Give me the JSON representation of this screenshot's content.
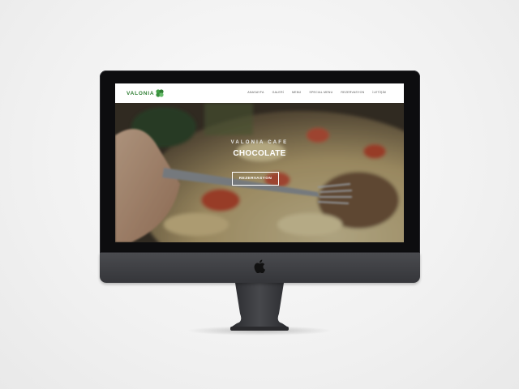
{
  "site": {
    "brand": "VALONIA",
    "brand_icon": "clover-leaf-icon",
    "brand_color": "#2e7d32"
  },
  "nav": {
    "items": [
      {
        "label": "ANASAYFA"
      },
      {
        "label": "GALERİ"
      },
      {
        "label": "MENÜ"
      },
      {
        "label": "SPECIAL MENU"
      },
      {
        "label": "REZERVASYON"
      },
      {
        "label": "İLETİŞİM"
      }
    ]
  },
  "hero": {
    "subtitle": "VALONIA CAFE",
    "title": "CHOCOLATE",
    "button_label": "REZERVASYON"
  },
  "device": {
    "logo_icon": "apple-logo-icon"
  }
}
